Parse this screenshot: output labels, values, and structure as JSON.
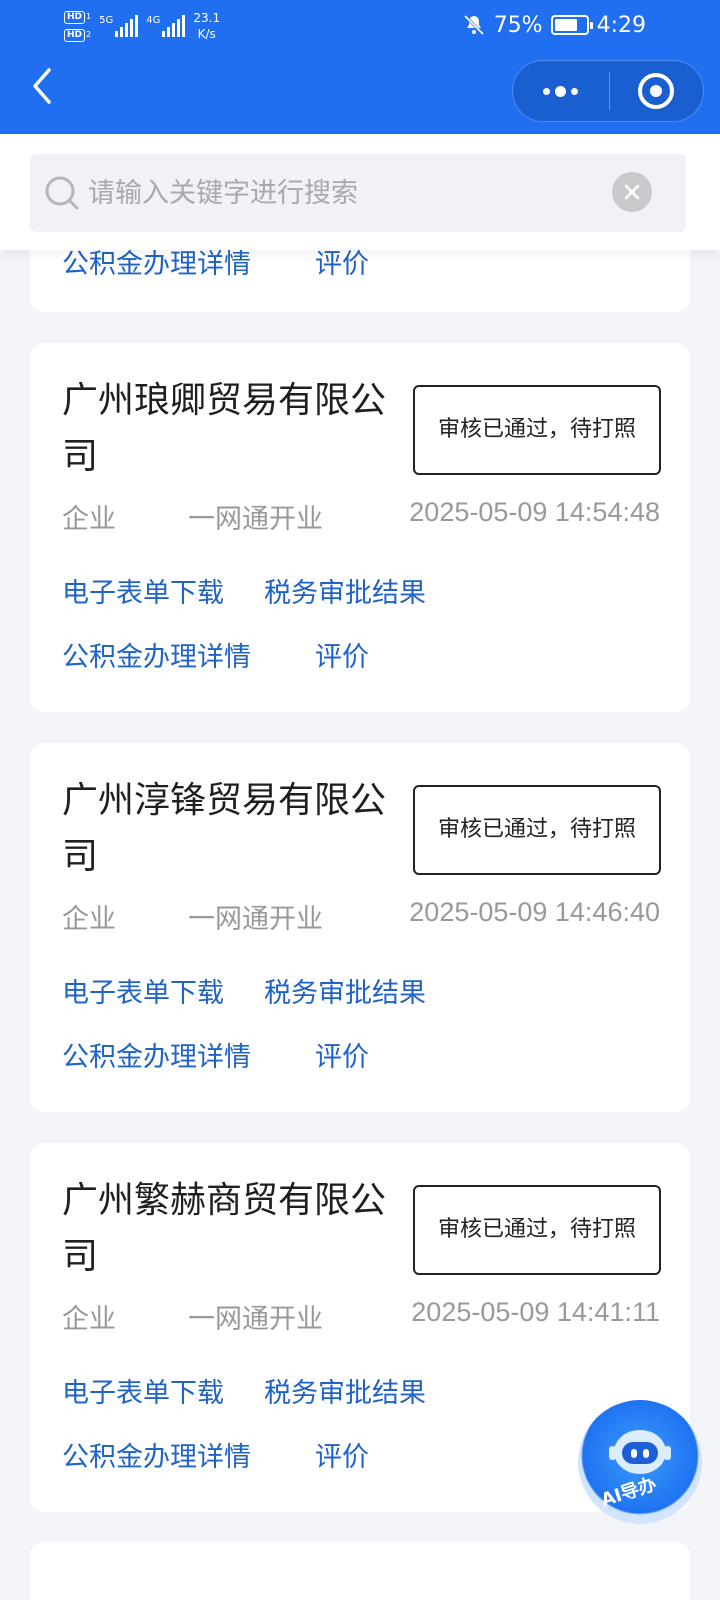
{
  "status_bar": {
    "hd1": "HD",
    "hd1_sub": "1",
    "hd2": "HD",
    "hd2_sub": "2",
    "net1": "5G",
    "net2": "4G",
    "speed": "23.1",
    "speed_unit": "K/s",
    "battery": "75%",
    "battery_level": 0.75,
    "time": "4:29"
  },
  "search": {
    "placeholder": "请输入关键字进行搜索"
  },
  "partial_card": {
    "links": [
      "公积金办理详情",
      "评价"
    ]
  },
  "cards": [
    {
      "name": "广州琅卿贸易有限公司",
      "status": "审核已通过，待打照",
      "type": "企业",
      "channel": "一网通开业",
      "time": "2025-05-09 14:54:48",
      "links_row1": [
        "电子表单下载",
        "税务审批结果"
      ],
      "links_row2": [
        "公积金办理详情",
        "评价"
      ]
    },
    {
      "name": "广州淳锋贸易有限公司",
      "status": "审核已通过，待打照",
      "type": "企业",
      "channel": "一网通开业",
      "time": "2025-05-09 14:46:40",
      "links_row1": [
        "电子表单下载",
        "税务审批结果"
      ],
      "links_row2": [
        "公积金办理详情",
        "评价"
      ]
    },
    {
      "name": "广州繁赫商贸有限公司",
      "status": "审核已通过，待打照",
      "type": "企业",
      "channel": "一网通开业",
      "time": "2025-05-09 14:41:11",
      "links_row1": [
        "电子表单下载",
        "税务审批结果"
      ],
      "links_row2": [
        "公积金办理详情",
        "评价"
      ]
    }
  ],
  "ai_button": {
    "label": "AI导办"
  },
  "colors": {
    "header": "#1f6ff0",
    "link": "#1f63c9",
    "background": "#f3f4f8"
  }
}
